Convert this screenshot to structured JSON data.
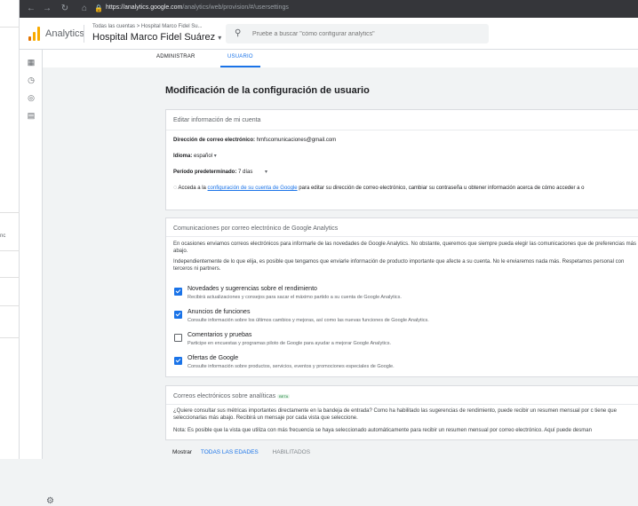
{
  "browser": {
    "url_host": "https://analytics.google.com",
    "url_path": "/analytics/web/provision/#/usersettings"
  },
  "left_strip": {
    "text": "nc"
  },
  "header": {
    "app_name": "Analytics",
    "breadcrumb": "Todas las cuentas > Hospital Marco Fidel Su...",
    "property": "Hospital Marco Fidel Suárez",
    "search_placeholder": "Pruebe a buscar \"cómo configurar analytics\""
  },
  "tabs": [
    {
      "label": "ADMINISTRAR"
    },
    {
      "label": "USUARIO"
    }
  ],
  "page_title": "Modificación de la configuración de usuario",
  "account_card": {
    "title": "Editar información de mi cuenta",
    "email_label": "Dirección de correo electrónico:",
    "email_value": "hmfscomunicaciones@gmail.com",
    "language_label": "Idioma:",
    "language_value": "español",
    "period_label": "Período predeterminado:",
    "period_value": "7 días",
    "note_prefix": "Acceda a la",
    "note_link": "configuración de su cuenta de Google",
    "note_suffix": "para editar su dirección de correo electrónico, cambiar su contraseña u obtener información acerca de cómo acceder a o"
  },
  "email_card": {
    "title": "Comunicaciones por correo electrónico de Google Analytics",
    "para1": "En ocasiones enviamos correos electrónicos para informarle de las novedades de Google Analytics. No obstante, queremos que siempre pueda elegir las comunicaciones que de preferencias más abajo.",
    "para2": "Independientemente de lo que elija, es posible que tengamos que enviarle información de producto importante que afecte a su cuenta. No le enviaremos nada más. Respetamos personal con terceros ni partners.",
    "options": [
      {
        "title": "Novedades y sugerencias sobre el rendimiento",
        "desc": "Recibirá actualizaciones y consejos para sacar el máximo partido a su cuenta de Google Analytics.",
        "checked": true
      },
      {
        "title": "Anuncios de funciones",
        "desc": "Consulte información sobre los últimos cambios y mejoras, así como las nuevas funciones de Google Analytics.",
        "checked": true
      },
      {
        "title": "Comentarios y pruebas",
        "desc": "Participe en encuestas y programas piloto de Google para ayudar a mejorar Google Analytics.",
        "checked": false
      },
      {
        "title": "Ofertas de Google",
        "desc": "Consulte información sobre productos, servicios, eventos y promociones especiales de Google.",
        "checked": true
      }
    ]
  },
  "analytics_card": {
    "title": "Correos electrónicos sobre analíticas",
    "badge": "BETA",
    "para1": "¿Quiere consultar sus métricas importantes directamente en la bandeja de entrada? Como ha habilitado las sugerencias de rendimiento, puede recibir un resumen mensual por c tiene que seleccionarlas más abajo. Recibirá un mensaje por cada vista que seleccione.",
    "para2": "Nota: Es posible que la vista que utiliza con más frecuencia se haya seleccionado automáticamente para recibir un resumen mensual por correo electrónico. Aquí puede desman"
  },
  "filter": {
    "label": "Mostrar",
    "opt1": "TODAS LAS EDADES",
    "opt2": "HABILITADOS"
  },
  "colors": {
    "accent": "#1a73e8",
    "logo_orange": "#f9ab00",
    "logo_dark": "#e37400"
  }
}
